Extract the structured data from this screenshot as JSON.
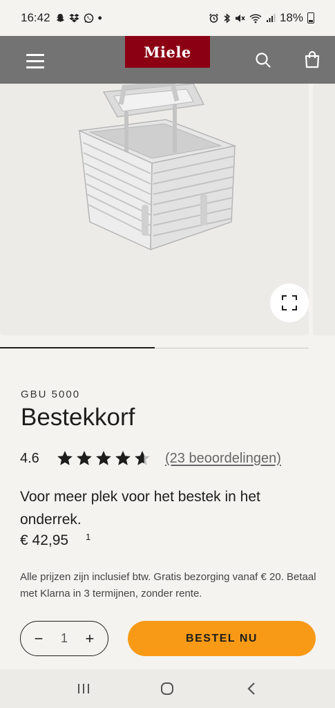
{
  "status_bar": {
    "time": "16:42",
    "battery": "18%",
    "left_icons": [
      "snapchat-icon",
      "dropbox-icon",
      "whatsapp-icon",
      "dot-icon"
    ],
    "right_icons": [
      "alarm-icon",
      "bluetooth-icon",
      "mute-icon",
      "wifi-icon",
      "signal-icon",
      "battery-icon"
    ]
  },
  "header": {
    "logo": "Miele",
    "icons": [
      "menu-icon",
      "search-icon",
      "shopping-bag-icon"
    ],
    "background": "#737373",
    "logo_color": "#8c0014"
  },
  "gallery": {
    "progress": 0.5,
    "zoom_icon": "fullscreen-icon"
  },
  "product": {
    "model": "GBU 5000",
    "title": "Bestekkorf",
    "rating_value": "4.6",
    "rating": 4.6,
    "rating_max": 5,
    "reviews_link": "(23 beoordelingen)",
    "description": "Voor meer plek voor het bestek in het onderrek.",
    "price": "€ 42,95",
    "price_footnote": "1",
    "tax_note": "Alle prijzen zijn inclusief btw. Gratis bezorging vanaf € 20. Betaal met Klarna in 3 termijnen, zonder rente."
  },
  "purchase": {
    "decrement": "−",
    "quantity": "1",
    "increment": "+",
    "cta_label": "BESTEL NU",
    "cta_color": "#f99a16"
  },
  "nav_bar": {
    "icons": [
      "recent-apps-icon",
      "home-icon",
      "back-icon"
    ]
  }
}
